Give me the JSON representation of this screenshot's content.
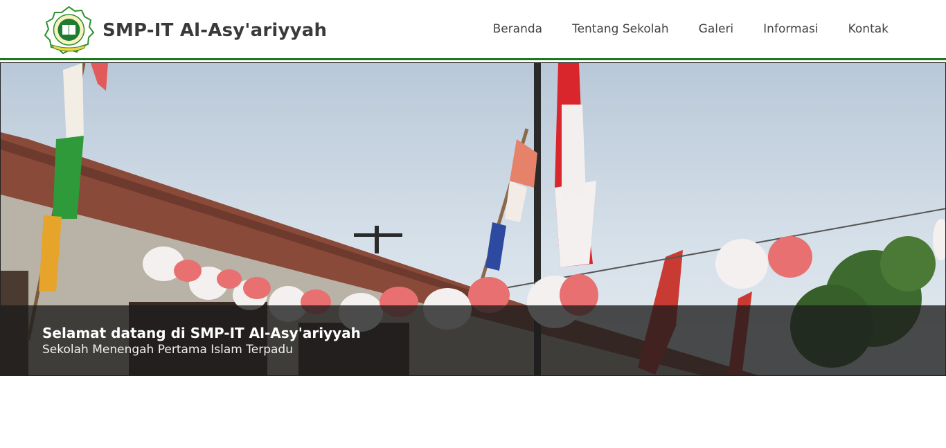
{
  "brand": {
    "name": "SMP-IT Al-Asy'ariyyah",
    "logo_icon": "school-emblem-icon"
  },
  "nav": {
    "items": [
      {
        "label": "Beranda"
      },
      {
        "label": "Tentang Sekolah"
      },
      {
        "label": "Galeri"
      },
      {
        "label": "Informasi"
      },
      {
        "label": "Kontak"
      }
    ]
  },
  "hero": {
    "title": "Selamat datang di SMP-IT Al-Asy'ariyyah",
    "subtitle": "Sekolah Menengah Pertama Islam Terpadu"
  },
  "colors": {
    "accent": "#1a7a1a",
    "text": "#444444"
  }
}
